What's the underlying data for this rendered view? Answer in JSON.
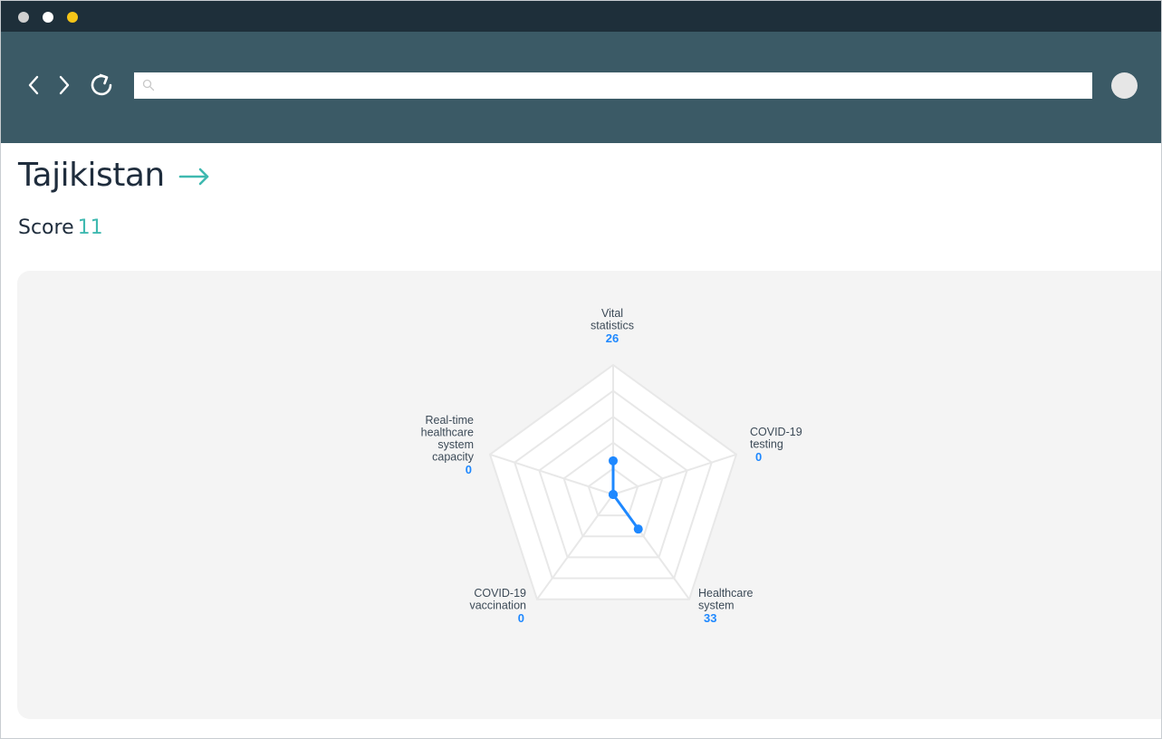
{
  "window": {
    "controls": [
      {
        "name": "close",
        "color": "#d0d0d0"
      },
      {
        "name": "minimize",
        "color": "#ffffff"
      },
      {
        "name": "maximize",
        "color": "#f5c518"
      }
    ]
  },
  "navbar": {
    "back_icon": "chevron-left-icon",
    "forward_icon": "chevron-right-icon",
    "reload_icon": "reload-icon",
    "search": {
      "value": "",
      "placeholder": "",
      "icon": "search-icon"
    },
    "avatar_icon": "avatar"
  },
  "page": {
    "title": "Tajikistan",
    "title_arrow_icon": "arrow-right-icon",
    "score_label": "Score",
    "score_value": "11",
    "accent_color": "#3fb9b0"
  },
  "chart_data": {
    "type": "radar",
    "max": 100,
    "rings": 5,
    "series_color": "#1e88ff",
    "axes": [
      {
        "label_lines": [
          "Vital",
          "statistics"
        ],
        "value": 26
      },
      {
        "label_lines": [
          "COVID-19",
          "testing"
        ],
        "value": 0
      },
      {
        "label_lines": [
          "Healthcare",
          "system"
        ],
        "value": 33
      },
      {
        "label_lines": [
          "COVID-19",
          "vaccination"
        ],
        "value": 0
      },
      {
        "label_lines": [
          "Real-time",
          "healthcare",
          "system",
          "capacity"
        ],
        "value": 0
      }
    ]
  }
}
